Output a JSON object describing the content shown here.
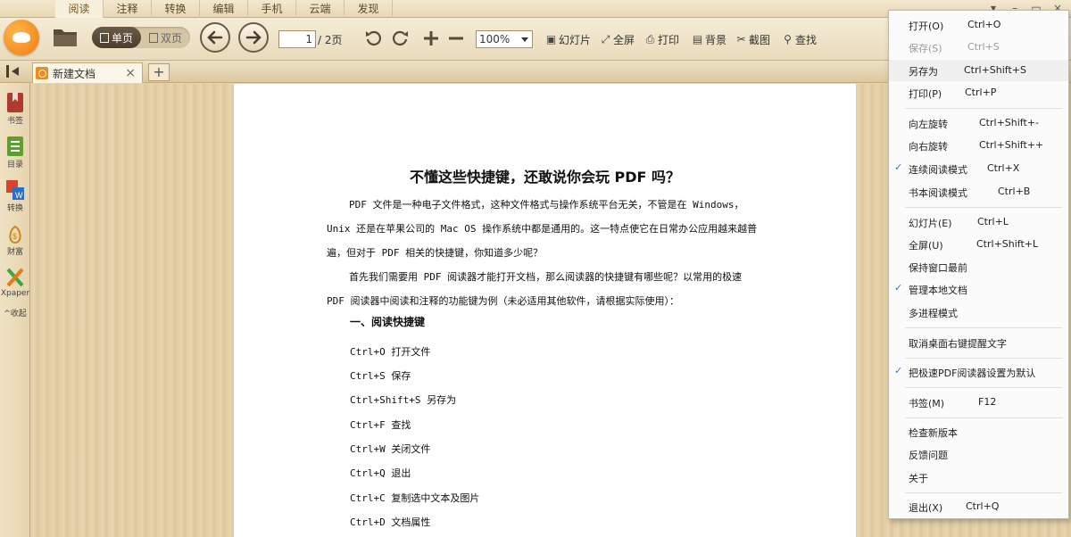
{
  "menu_tabs": [
    "阅读",
    "注释",
    "转换",
    "编辑",
    "手机",
    "云端",
    "发现"
  ],
  "window_controls": [
    "▾",
    "–",
    "▭",
    "×"
  ],
  "toolbar": {
    "view_single": "单页",
    "view_double": "双页",
    "page_current": "1",
    "page_total": "/ 2页",
    "zoom": "100%",
    "slideshow": "幻灯片",
    "fullscreen": "全屏",
    "print": "打印",
    "background": "背景",
    "screenshot": "截图",
    "find": "查找"
  },
  "tab": {
    "title": "新建文档",
    "close": "×",
    "add": "+"
  },
  "sidebar": {
    "items": [
      {
        "label": "书签",
        "icon": "bookmark-icon"
      },
      {
        "label": "目录",
        "icon": "toc-icon"
      },
      {
        "label": "转换",
        "icon": "convert-icon"
      },
      {
        "label": "财富",
        "icon": "wealth-icon"
      },
      {
        "label": "Xpaper",
        "icon": "xpaper-icon"
      }
    ],
    "collapse": "收起"
  },
  "document": {
    "title": "不懂这些快捷键，还敢说你会玩 PDF 吗？",
    "para1": "PDF 文件是一种电子文件格式，这种文件格式与操作系统平台无关，不管是在 Windows，Unix 还是在苹果公司的 Mac OS 操作系统中都是通用的。这一特点使它在日常办公应用越来越普遍，但对于 PDF 相关的快捷键，你知道多少呢？",
    "para2": "首先我们需要用 PDF 阅读器才能打开文档，那么阅读器的快捷键有哪些呢？以常用的极速 PDF 阅读器中阅读和注释的功能键为例（未必适用其他软件，请根据实际使用）：",
    "section": "一、阅读快捷键",
    "shortcuts": [
      "Ctrl+O 打开文件",
      "Ctrl+S 保存",
      "Ctrl+Shift+S 另存为",
      "Ctrl+F 查找",
      "Ctrl+W 关闭文件",
      "Ctrl+Q 退出",
      "Ctrl+C 复制选中文本及图片",
      "Ctrl+D 文档属性"
    ]
  },
  "menu": {
    "items": [
      {
        "label": "打开(O)",
        "shortcut": "Ctrl+O"
      },
      {
        "label": "保存(S)",
        "shortcut": "Ctrl+S"
      },
      {
        "label": "另存为",
        "shortcut": "Ctrl+Shift+S"
      },
      {
        "label": "打印(P)",
        "shortcut": "Ctrl+P"
      },
      {
        "label": "向左旋转",
        "shortcut": "Ctrl+Shift+-"
      },
      {
        "label": "向右旋转",
        "shortcut": "Ctrl+Shift++"
      },
      {
        "label": "连续阅读模式",
        "shortcut": "Ctrl+X"
      },
      {
        "label": "书本阅读模式",
        "shortcut": "Ctrl+B"
      },
      {
        "label": "幻灯片(E)",
        "shortcut": "Ctrl+L"
      },
      {
        "label": "全屏(U)",
        "shortcut": "Ctrl+Shift+L"
      },
      {
        "label": "保持窗口最前",
        "shortcut": ""
      },
      {
        "label": "管理本地文档",
        "shortcut": ""
      },
      {
        "label": "多进程模式",
        "shortcut": ""
      },
      {
        "label": "取消桌面右键提醒文字",
        "shortcut": ""
      },
      {
        "label": "把极速PDF阅读器设置为默认",
        "shortcut": ""
      },
      {
        "label": "书签(M)",
        "shortcut": "F12"
      },
      {
        "label": "检查新版本",
        "shortcut": ""
      },
      {
        "label": "反馈问题",
        "shortcut": ""
      },
      {
        "label": "关于",
        "shortcut": ""
      },
      {
        "label": "退出(X)",
        "shortcut": "Ctrl+Q"
      }
    ],
    "checked": [
      "连续阅读模式",
      "管理本地文档",
      "把极速PDF阅读器设置为默认"
    ],
    "disabled": [
      "保存(S)"
    ],
    "highlighted": "另存为"
  },
  "colors": {
    "accent_orange": "#f07b10",
    "check_blue": "#3a74c9",
    "toolbar_bg": "#efe3c6"
  }
}
